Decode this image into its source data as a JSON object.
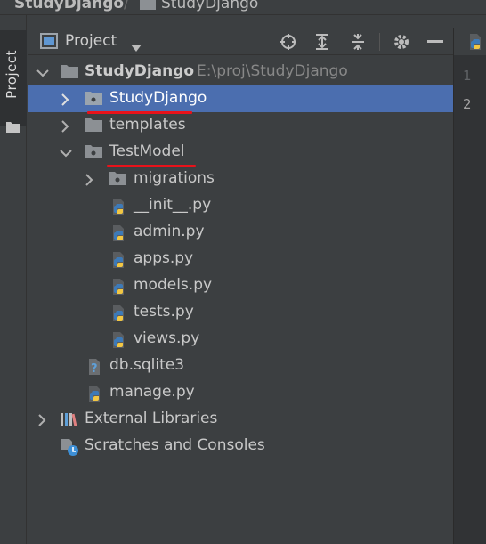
{
  "breadcrumb": {
    "root": "StudyDjango",
    "separator": "/",
    "child": "StudyDjango"
  },
  "tool_stripe": {
    "project_tab_label": "Project"
  },
  "panel": {
    "title": "Project",
    "tools": [
      "locate-icon",
      "expand-all-icon",
      "collapse-all-icon",
      "gear-icon",
      "minimize-icon"
    ]
  },
  "tree": {
    "root": {
      "name": "StudyDjango",
      "path": "E:\\proj\\StudyDjango"
    },
    "studydjango_pkg": "StudyDjango",
    "templates": "templates",
    "testmodel": "TestModel",
    "migrations": "migrations",
    "init": "__init__.py",
    "admin": "admin.py",
    "apps": "apps.py",
    "models": "models.py",
    "tests": "tests.py",
    "views": "views.py",
    "db": "db.sqlite3",
    "manage": "manage.py",
    "external_libraries": "External Libraries",
    "scratches": "Scratches and Consoles"
  },
  "editor": {
    "line_numbers": [
      "1",
      "2"
    ]
  },
  "colors": {
    "selection": "#4b6eaf",
    "annotation_underline": "#e8121a",
    "panel_bg": "#3c3f41"
  }
}
